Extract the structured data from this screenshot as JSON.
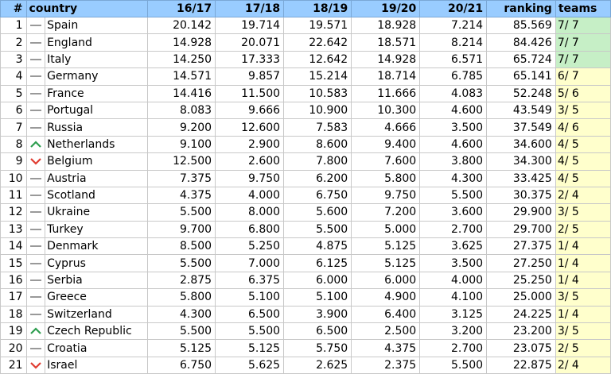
{
  "table": {
    "headers": [
      "#",
      "country",
      "16/17",
      "17/18",
      "18/19",
      "19/20",
      "20/21",
      "ranking",
      "teams"
    ],
    "colors": {
      "header_bg": "#99ccff",
      "teams_green": "#c6efc6",
      "teams_yellow": "#ffffcc",
      "trend_up": "#2e9e4f",
      "trend_down": "#e03c31",
      "trend_same": "#999999"
    },
    "rows": [
      {
        "rank": "1",
        "trend": "same",
        "country": "Spain",
        "s1617": "20.142",
        "s1718": "19.714",
        "s1819": "19.571",
        "s1920": "18.928",
        "s2021": "7.214",
        "ranking": "85.569",
        "teams": "7/ 7",
        "teams_status": "green"
      },
      {
        "rank": "2",
        "trend": "same",
        "country": "England",
        "s1617": "14.928",
        "s1718": "20.071",
        "s1819": "22.642",
        "s1920": "18.571",
        "s2021": "8.214",
        "ranking": "84.426",
        "teams": "7/ 7",
        "teams_status": "green"
      },
      {
        "rank": "3",
        "trend": "same",
        "country": "Italy",
        "s1617": "14.250",
        "s1718": "17.333",
        "s1819": "12.642",
        "s1920": "14.928",
        "s2021": "6.571",
        "ranking": "65.724",
        "teams": "7/ 7",
        "teams_status": "green"
      },
      {
        "rank": "4",
        "trend": "same",
        "country": "Germany",
        "s1617": "14.571",
        "s1718": "9.857",
        "s1819": "15.214",
        "s1920": "18.714",
        "s2021": "6.785",
        "ranking": "65.141",
        "teams": "6/ 7",
        "teams_status": "yellow"
      },
      {
        "rank": "5",
        "trend": "same",
        "country": "France",
        "s1617": "14.416",
        "s1718": "11.500",
        "s1819": "10.583",
        "s1920": "11.666",
        "s2021": "4.083",
        "ranking": "52.248",
        "teams": "5/ 6",
        "teams_status": "yellow"
      },
      {
        "rank": "6",
        "trend": "same",
        "country": "Portugal",
        "s1617": "8.083",
        "s1718": "9.666",
        "s1819": "10.900",
        "s1920": "10.300",
        "s2021": "4.600",
        "ranking": "43.549",
        "teams": "3/ 5",
        "teams_status": "yellow"
      },
      {
        "rank": "7",
        "trend": "same",
        "country": "Russia",
        "s1617": "9.200",
        "s1718": "12.600",
        "s1819": "7.583",
        "s1920": "4.666",
        "s2021": "3.500",
        "ranking": "37.549",
        "teams": "4/ 6",
        "teams_status": "yellow"
      },
      {
        "rank": "8",
        "trend": "up",
        "country": "Netherlands",
        "s1617": "9.100",
        "s1718": "2.900",
        "s1819": "8.600",
        "s1920": "9.400",
        "s2021": "4.600",
        "ranking": "34.600",
        "teams": "4/ 5",
        "teams_status": "yellow"
      },
      {
        "rank": "9",
        "trend": "down",
        "country": "Belgium",
        "s1617": "12.500",
        "s1718": "2.600",
        "s1819": "7.800",
        "s1920": "7.600",
        "s2021": "3.800",
        "ranking": "34.300",
        "teams": "4/ 5",
        "teams_status": "yellow"
      },
      {
        "rank": "10",
        "trend": "same",
        "country": "Austria",
        "s1617": "7.375",
        "s1718": "9.750",
        "s1819": "6.200",
        "s1920": "5.800",
        "s2021": "4.300",
        "ranking": "33.425",
        "teams": "4/ 5",
        "teams_status": "yellow"
      },
      {
        "rank": "11",
        "trend": "same",
        "country": "Scotland",
        "s1617": "4.375",
        "s1718": "4.000",
        "s1819": "6.750",
        "s1920": "9.750",
        "s2021": "5.500",
        "ranking": "30.375",
        "teams": "2/ 4",
        "teams_status": "yellow"
      },
      {
        "rank": "12",
        "trend": "same",
        "country": "Ukraine",
        "s1617": "5.500",
        "s1718": "8.000",
        "s1819": "5.600",
        "s1920": "7.200",
        "s2021": "3.600",
        "ranking": "29.900",
        "teams": "3/ 5",
        "teams_status": "yellow"
      },
      {
        "rank": "13",
        "trend": "same",
        "country": "Turkey",
        "s1617": "9.700",
        "s1718": "6.800",
        "s1819": "5.500",
        "s1920": "5.000",
        "s2021": "2.700",
        "ranking": "29.700",
        "teams": "2/ 5",
        "teams_status": "yellow"
      },
      {
        "rank": "14",
        "trend": "same",
        "country": "Denmark",
        "s1617": "8.500",
        "s1718": "5.250",
        "s1819": "4.875",
        "s1920": "5.125",
        "s2021": "3.625",
        "ranking": "27.375",
        "teams": "1/ 4",
        "teams_status": "yellow"
      },
      {
        "rank": "15",
        "trend": "same",
        "country": "Cyprus",
        "s1617": "5.500",
        "s1718": "7.000",
        "s1819": "6.125",
        "s1920": "5.125",
        "s2021": "3.500",
        "ranking": "27.250",
        "teams": "1/ 4",
        "teams_status": "yellow"
      },
      {
        "rank": "16",
        "trend": "same",
        "country": "Serbia",
        "s1617": "2.875",
        "s1718": "6.375",
        "s1819": "6.000",
        "s1920": "6.000",
        "s2021": "4.000",
        "ranking": "25.250",
        "teams": "1/ 4",
        "teams_status": "yellow"
      },
      {
        "rank": "17",
        "trend": "same",
        "country": "Greece",
        "s1617": "5.800",
        "s1718": "5.100",
        "s1819": "5.100",
        "s1920": "4.900",
        "s2021": "4.100",
        "ranking": "25.000",
        "teams": "3/ 5",
        "teams_status": "yellow"
      },
      {
        "rank": "18",
        "trend": "same",
        "country": "Switzerland",
        "s1617": "4.300",
        "s1718": "6.500",
        "s1819": "3.900",
        "s1920": "6.400",
        "s2021": "3.125",
        "ranking": "24.225",
        "teams": "1/ 4",
        "teams_status": "yellow"
      },
      {
        "rank": "19",
        "trend": "up",
        "country": "Czech Republic",
        "s1617": "5.500",
        "s1718": "5.500",
        "s1819": "6.500",
        "s1920": "2.500",
        "s2021": "3.200",
        "ranking": "23.200",
        "teams": "3/ 5",
        "teams_status": "yellow"
      },
      {
        "rank": "20",
        "trend": "same",
        "country": "Croatia",
        "s1617": "5.125",
        "s1718": "5.125",
        "s1819": "5.750",
        "s1920": "4.375",
        "s2021": "2.700",
        "ranking": "23.075",
        "teams": "2/ 5",
        "teams_status": "yellow"
      },
      {
        "rank": "21",
        "trend": "down",
        "country": "Israel",
        "s1617": "6.750",
        "s1718": "5.625",
        "s1819": "2.625",
        "s1920": "2.375",
        "s2021": "5.500",
        "ranking": "22.875",
        "teams": "2/ 4",
        "teams_status": "yellow"
      }
    ]
  }
}
